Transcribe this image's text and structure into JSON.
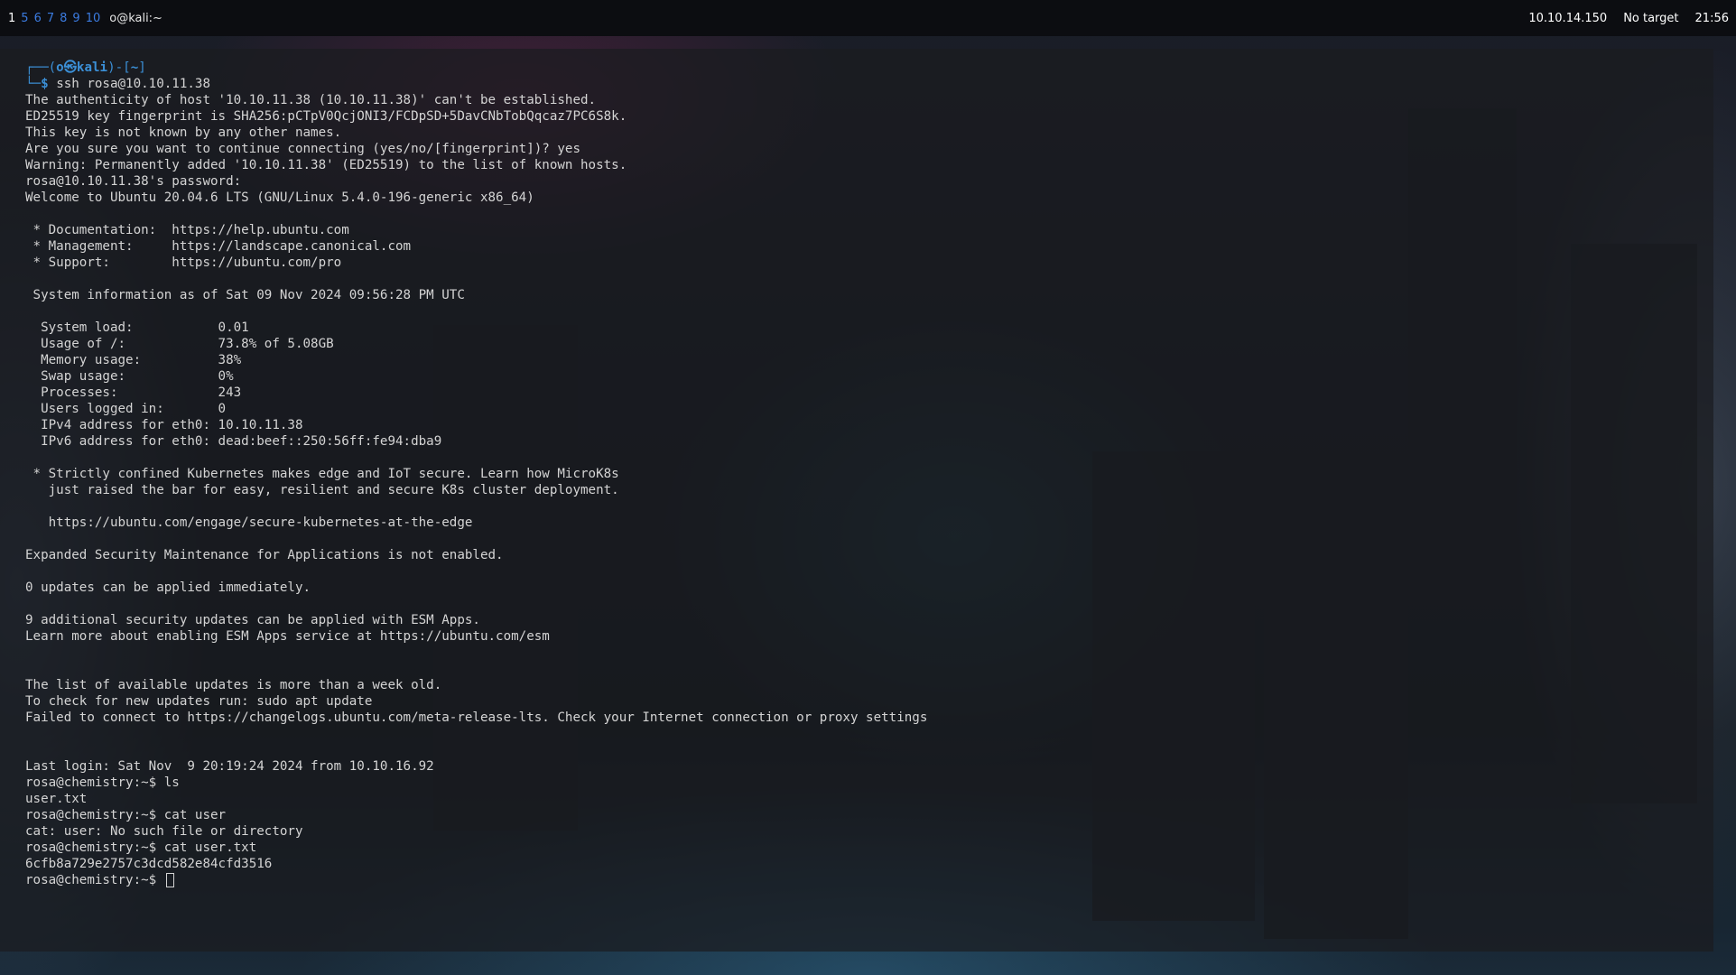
{
  "topbar": {
    "workspaces": [
      "1",
      "5",
      "6",
      "7",
      "8",
      "9",
      "10"
    ],
    "active_workspace": "1",
    "window_title": "o@kali:~",
    "ip_address": "10.10.14.150",
    "target": "No target",
    "clock": "21:56"
  },
  "terminal": {
    "prompt": {
      "box_top": "┌──(",
      "user": "o㉿kali",
      "box_mid": ")-[",
      "cwd": "~",
      "box_end": "]",
      "box_bottom": "└─",
      "symbol": "$ ",
      "command": "ssh rosa@10.10.11.38"
    },
    "lines": [
      "The authenticity of host '10.10.11.38 (10.10.11.38)' can't be established.",
      "ED25519 key fingerprint is SHA256:pCTpV0QcjONI3/FCDpSD+5DavCNbTobQqcaz7PC6S8k.",
      "This key is not known by any other names.",
      "Are you sure you want to continue connecting (yes/no/[fingerprint])? yes",
      "Warning: Permanently added '10.10.11.38' (ED25519) to the list of known hosts.",
      "rosa@10.10.11.38's password:",
      "Welcome to Ubuntu 20.04.6 LTS (GNU/Linux 5.4.0-196-generic x86_64)",
      "",
      " * Documentation:  https://help.ubuntu.com",
      " * Management:     https://landscape.canonical.com",
      " * Support:        https://ubuntu.com/pro",
      "",
      " System information as of Sat 09 Nov 2024 09:56:28 PM UTC",
      "",
      "  System load:           0.01",
      "  Usage of /:            73.8% of 5.08GB",
      "  Memory usage:          38%",
      "  Swap usage:            0%",
      "  Processes:             243",
      "  Users logged in:       0",
      "  IPv4 address for eth0: 10.10.11.38",
      "  IPv6 address for eth0: dead:beef::250:56ff:fe94:dba9",
      "",
      " * Strictly confined Kubernetes makes edge and IoT secure. Learn how MicroK8s",
      "   just raised the bar for easy, resilient and secure K8s cluster deployment.",
      "",
      "   https://ubuntu.com/engage/secure-kubernetes-at-the-edge",
      "",
      "Expanded Security Maintenance for Applications is not enabled.",
      "",
      "0 updates can be applied immediately.",
      "",
      "9 additional security updates can be applied with ESM Apps.",
      "Learn more about enabling ESM Apps service at https://ubuntu.com/esm",
      "",
      "",
      "The list of available updates is more than a week old.",
      "To check for new updates run: sudo apt update",
      "Failed to connect to https://changelogs.ubuntu.com/meta-release-lts. Check your Internet connection or proxy settings",
      "",
      "",
      "Last login: Sat Nov  9 20:19:24 2024 from 10.10.16.92",
      "rosa@chemistry:~$ ls",
      "user.txt",
      "rosa@chemistry:~$ cat user",
      "cat: user: No such file or directory",
      "rosa@chemistry:~$ cat user.txt",
      "6cfb8a729e2757c3dcd582e84cfd3516"
    ],
    "final_prompt": "rosa@chemistry:~$ "
  }
}
